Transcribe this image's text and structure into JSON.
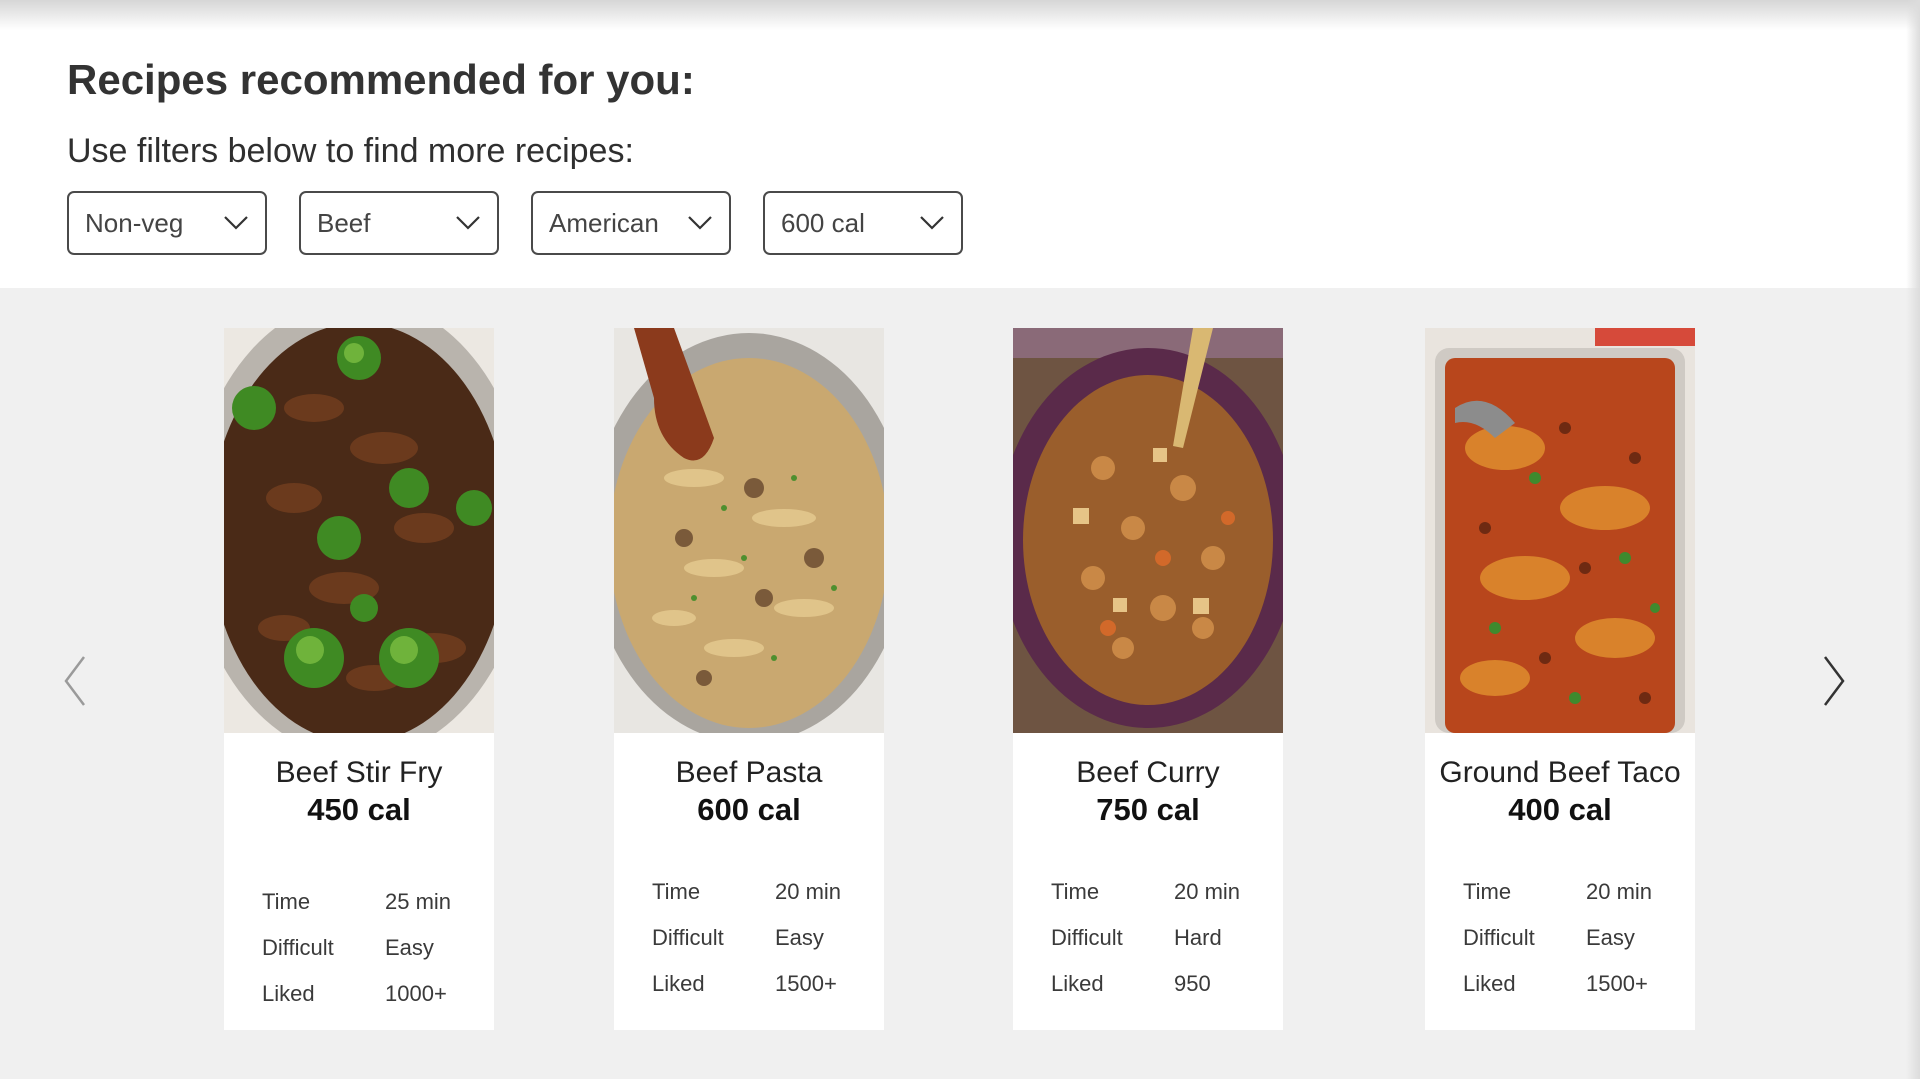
{
  "header": {
    "title": "Recipes recommended for you:",
    "subtitle": "Use filters below to find more recipes:"
  },
  "filters": [
    {
      "label": "Non-veg"
    },
    {
      "label": "Beef"
    },
    {
      "label": "American"
    },
    {
      "label": "600 cal"
    }
  ],
  "recipes": [
    {
      "name": "Beef Stir Fry",
      "calories": "450 cal",
      "time_label": "Time",
      "time": "25 min",
      "difficulty_label": "Difficult",
      "difficulty": "Easy",
      "liked_label": "Liked",
      "liked": "1000+"
    },
    {
      "name": "Beef Pasta",
      "calories": "600 cal",
      "time_label": "Time",
      "time": "20 min",
      "difficulty_label": "Difficult",
      "difficulty": "Easy",
      "liked_label": "Liked",
      "liked": "1500+"
    },
    {
      "name": "Beef Curry",
      "calories": "750 cal",
      "time_label": "Time",
      "time": "20 min",
      "difficulty_label": "Difficult",
      "difficulty": "Hard",
      "liked_label": "Liked",
      "liked": "950"
    },
    {
      "name": "Ground Beef Taco",
      "calories": "400 cal",
      "time_label": "Time",
      "time": "20 min",
      "difficulty_label": "Difficult",
      "difficulty": "Easy",
      "liked_label": "Liked",
      "liked": "1500+"
    }
  ],
  "icons": {
    "filter_dropdown": "chevron-down-icon",
    "carousel_prev": "chevron-left-icon",
    "carousel_next": "chevron-right-icon"
  },
  "colors": {
    "page_background": "#ffffff",
    "carousel_background": "#f0f0f0",
    "card_background": "#ffffff",
    "border": "#4a4a4a"
  }
}
